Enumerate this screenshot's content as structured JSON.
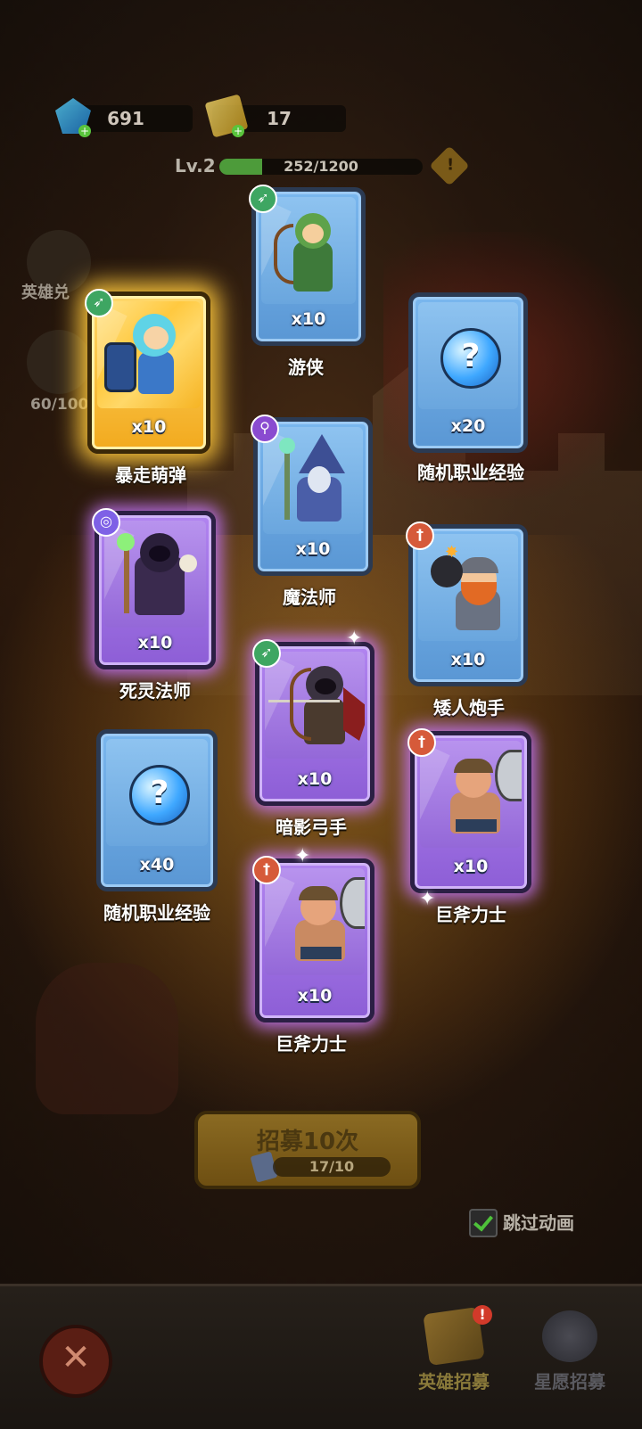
{
  "resources": {
    "gems": "691",
    "tickets": "17"
  },
  "level": {
    "label": "Lv.2",
    "progress_text": "252/1200",
    "progress_fraction": 0.21
  },
  "side": {
    "hero_exchange_label": "英雄兑",
    "star_progress": "60/100"
  },
  "cards": [
    {
      "name": "游侠",
      "count": "x10",
      "rarity": "blue",
      "class": "bow"
    },
    {
      "name": "暴走萌弹",
      "count": "x10",
      "rarity": "gold",
      "class": "bow"
    },
    {
      "name": "随机职业经验",
      "count": "x20",
      "rarity": "blue",
      "class": "random"
    },
    {
      "name": "魔法师",
      "count": "x10",
      "rarity": "blue",
      "class": "staff"
    },
    {
      "name": "死灵法师",
      "count": "x10",
      "rarity": "purple",
      "class": "spiral"
    },
    {
      "name": "矮人炮手",
      "count": "x10",
      "rarity": "blue",
      "class": "sword"
    },
    {
      "name": "暗影弓手",
      "count": "x10",
      "rarity": "purple",
      "class": "bow"
    },
    {
      "name": "随机职业经验",
      "count": "x40",
      "rarity": "blue",
      "class": "random"
    },
    {
      "name": "巨斧力士",
      "count": "x10",
      "rarity": "purple",
      "class": "sword"
    },
    {
      "name": "巨斧力士",
      "count": "x10",
      "rarity": "purple",
      "class": "sword"
    }
  ],
  "recruit": {
    "title": "招募10次",
    "cost": "17/10"
  },
  "skip_animation": {
    "label": "跳过动画",
    "checked": true
  },
  "bottom_nav": {
    "hero_recruit": "英雄招募",
    "star_recruit": "星愿招募"
  },
  "colors": {
    "blue_card": "#6aa6de",
    "purple_card": "#9468d8",
    "gold_card": "#ffc940"
  }
}
